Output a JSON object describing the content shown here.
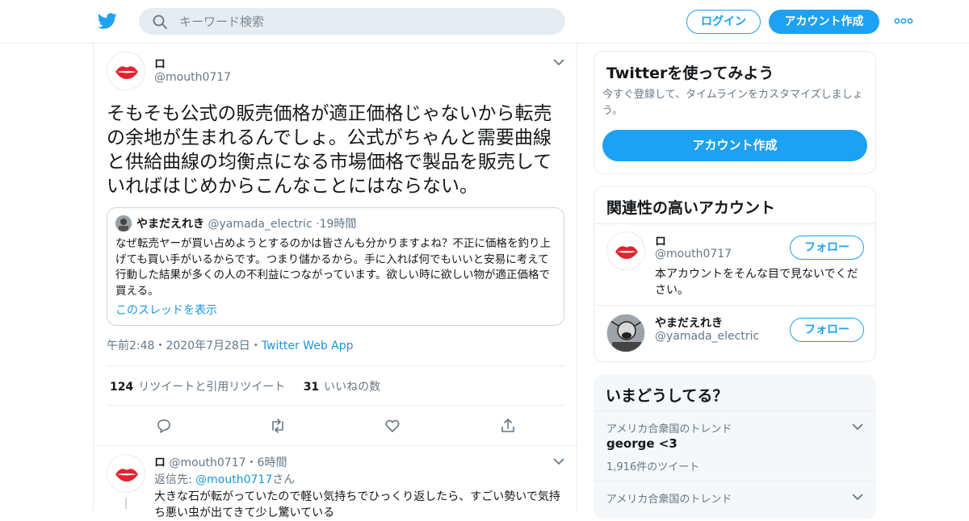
{
  "header": {
    "search_placeholder": "キーワード検索",
    "login_label": "ログイン",
    "signup_label": "アカウント作成"
  },
  "tweet": {
    "author_name": "ロ",
    "author_handle": "@mouth0717",
    "text": "そもそも公式の販売価格が適正価格じゃないから転売の余地が生まれるんでしょ。公式がちゃんと需要曲線と供給曲線の均衡点になる市場価格で製品を販売していればはじめからこんなことにはならない。",
    "quote": {
      "name": "やまだえれき",
      "handle": "@yamada_electric",
      "time": "19時間",
      "text": "なぜ転売ヤーが買い占めようとするのかは皆さんも分かりますよね？不正に価格を釣り上げても買い手がいるからです。つまり儲かるから。手に入れば何でもいいと安易に考えて行動した結果が多くの人の不利益につながっています。欲しい時に欲しい物が適正価格で買える。",
      "thread_link": "このスレッドを表示"
    },
    "time": "午前2:48",
    "date": "2020年7月28日",
    "source": "Twitter Web App",
    "retweet_count": "124",
    "retweet_label": "リツイートと引用リツイート",
    "like_count": "31",
    "like_label": "いいねの数"
  },
  "reply": {
    "author_name": "ロ",
    "author_handle": "@mouth0717",
    "time": "6時間",
    "reply_to_prefix": "返信先: ",
    "reply_to_handle": "@mouth0717",
    "reply_to_suffix": "さん",
    "text": "大きな石が転がっていたので軽い気持ちでひっくり返したら、すごい勢いで気持ち悪い虫が出てきて少し驚いている"
  },
  "signup_card": {
    "title": "Twitterを使ってみよう",
    "subtitle": "今すぐ登録して、タイムラインをカスタマイズしましょう。",
    "button_label": "アカウント作成"
  },
  "related": {
    "title": "関連性の高いアカウント",
    "accounts": [
      {
        "name": "ロ",
        "handle": "@mouth0717",
        "bio": "本アカウントをそんな目で見ないでください。",
        "follow_label": "フォロー"
      },
      {
        "name": "やまだえれき",
        "handle": "@yamada_electric",
        "follow_label": "フォロー"
      }
    ]
  },
  "trends": {
    "title": "いまどうしてる？",
    "items": [
      {
        "context": "アメリカ合衆国のトレンド",
        "name": "george <3",
        "count": "1,916件のツイート"
      },
      {
        "context": "アメリカ合衆国のトレンド"
      }
    ]
  },
  "colors": {
    "accent": "#1da1f2",
    "link": "#1b95e0",
    "muted": "#657786"
  }
}
